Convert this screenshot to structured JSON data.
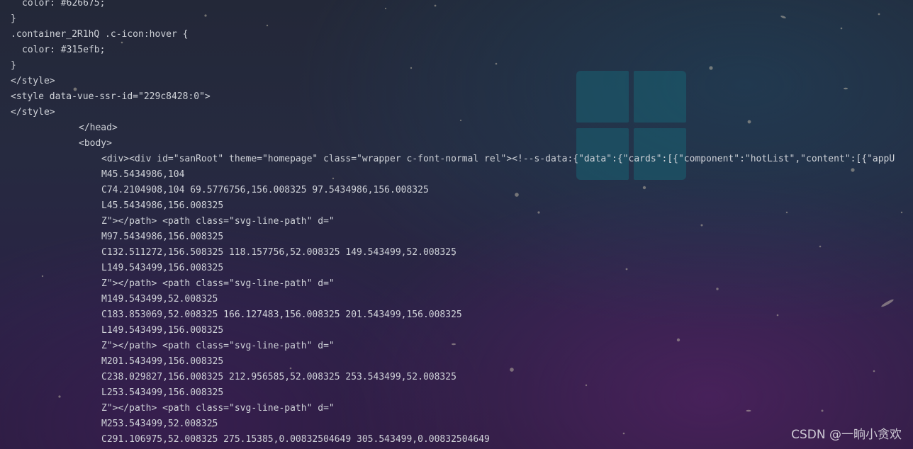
{
  "code_lines": [
    "color: #626675;",
    "}",
    ".container_2R1hQ .c-icon:hover {",
    "color: #315efb;",
    "}",
    "</style>",
    "<style data-vue-ssr-id=\"229c8428:0\">",
    "</style>",
    "</head>",
    "<body>",
    "<div><div id=\"sanRoot\" theme=\"homepage\" class=\"wrapper c-font-normal rel\"><!--s-data:{\"data\":{\"cards\":[{\"component\":\"hotList\",\"content\":[{\"appU",
    "M45.5434986,104",
    "C74.2104908,104 69.5776756,156.008325 97.5434986,156.008325",
    "L45.5434986,156.008325",
    "Z\"></path> <path class=\"svg-line-path\" d=\"",
    "M97.5434986,156.008325",
    "C132.511272,156.508325 118.157756,52.008325 149.543499,52.008325",
    "L149.543499,156.008325",
    "Z\"></path> <path class=\"svg-line-path\" d=\"",
    "M149.543499,52.008325",
    "C183.853069,52.008325 166.127483,156.008325 201.543499,156.008325",
    "L149.543499,156.008325",
    "Z\"></path> <path class=\"svg-line-path\" d=\"",
    "M201.543499,156.008325",
    "C238.029827,156.008325 212.956585,52.008325 253.543499,52.008325",
    "L253.543499,156.008325",
    "Z\"></path> <path class=\"svg-line-path\" d=\"",
    "M253.543499,52.008325",
    "C291.106975,52.008325 275.15385,0.00832504649 305.543499,0.00832504649"
  ],
  "watermark": "CSDN @一晌小贪欢",
  "colors": {
    "code_text": "#cfd2d8",
    "logo_tile": "#1a5c6e"
  },
  "icons": {
    "logo": "windows-logo-icon"
  }
}
